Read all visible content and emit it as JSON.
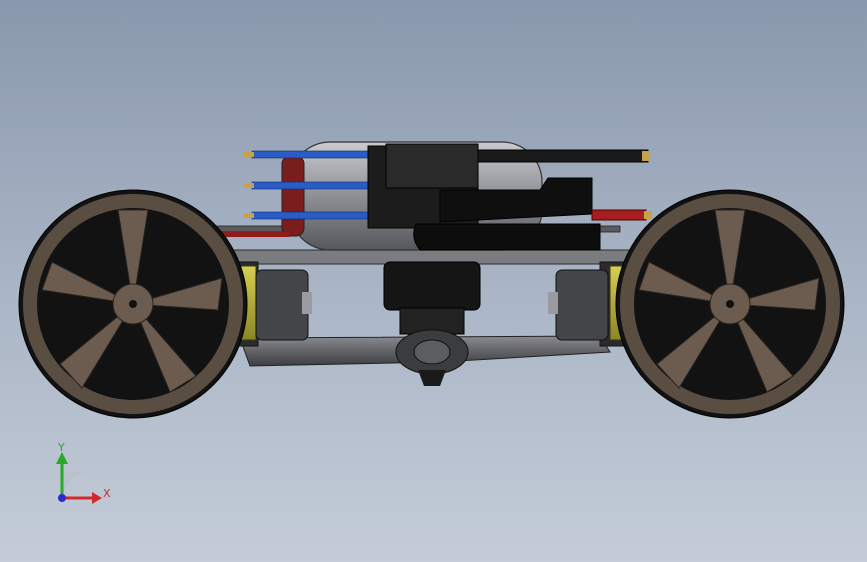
{
  "viewport": {
    "background_top": "#8a98ad",
    "background_bottom": "#c4ccd8"
  },
  "colors": {
    "tire": "#121212",
    "rim": "#6b5c4f",
    "motor_yellow": "#b9b23a",
    "chassis": "#6e6f73",
    "body_dark": "#1a1a1a",
    "wire_blue": "#2a5cc8",
    "wire_red": "#a61e1e",
    "brass": "#c8a24a",
    "battery": "#8e9096"
  },
  "triad": {
    "x_label": "X",
    "y_label": "Y",
    "x_color": "#d02a2a",
    "y_color": "#2aa82a",
    "z_color": "#2a2ad0"
  }
}
